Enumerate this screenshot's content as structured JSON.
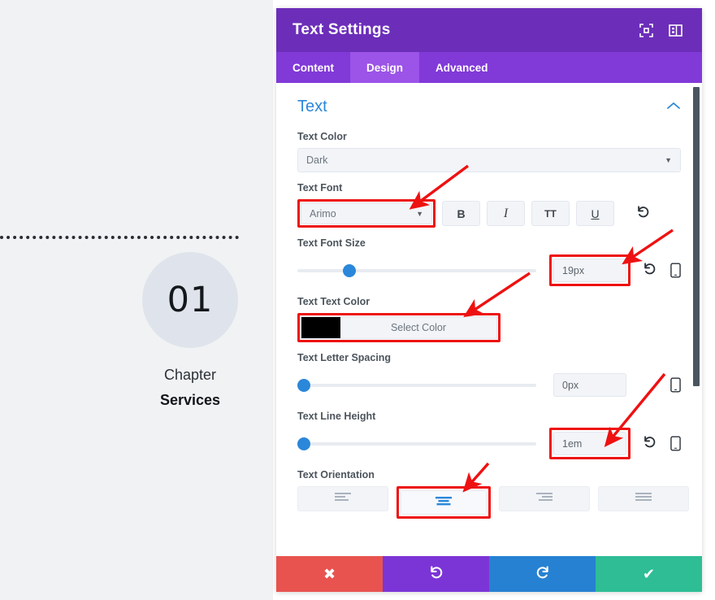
{
  "preview": {
    "chapter_number": "01",
    "chapter_label": "Chapter",
    "chapter_title": "Services",
    "divider_icon": "dotted-divider"
  },
  "panel": {
    "title": "Text Settings",
    "header_icons": [
      {
        "name": "expand-icon",
        "label": "expand"
      },
      {
        "name": "layout-toggle-icon",
        "label": "layout"
      }
    ],
    "tabs": [
      {
        "label": "Content",
        "active": false
      },
      {
        "label": "Design",
        "active": true
      },
      {
        "label": "Advanced",
        "active": false
      }
    ],
    "section": {
      "title": "Text",
      "collapse_icon": "chevron-up-icon"
    },
    "fields": {
      "text_color": {
        "label": "Text Color",
        "value": "Dark",
        "caret_icon": "chevron-down-icon"
      },
      "text_font": {
        "label": "Text Font",
        "value": "Arimo",
        "caret_icon": "chevron-down-icon",
        "highlighted": true,
        "format_buttons": [
          {
            "name": "bold-button",
            "label": "B"
          },
          {
            "name": "italic-button",
            "label": "I"
          },
          {
            "name": "uppercase-button",
            "label": "TT"
          },
          {
            "name": "underline-button",
            "label": "U"
          }
        ],
        "reset_icon": "reset-icon"
      },
      "text_font_size": {
        "label": "Text Font Size",
        "value": "19px",
        "slider_percent": 19,
        "highlighted": true,
        "reset_icon": "reset-icon",
        "device_icon": "mobile-icon"
      },
      "text_text_color": {
        "label": "Text Text Color",
        "button_label": "Select Color",
        "swatch_color": "#000000",
        "highlighted": true
      },
      "text_letter_spacing": {
        "label": "Text Letter Spacing",
        "value": "0px",
        "slider_percent": 0,
        "highlighted": false,
        "device_icon": "mobile-icon"
      },
      "text_line_height": {
        "label": "Text Line Height",
        "value": "1em",
        "slider_percent": 0,
        "highlighted": true,
        "reset_icon": "reset-icon",
        "device_icon": "mobile-icon"
      },
      "text_orientation": {
        "label": "Text Orientation",
        "options": [
          {
            "name": "align-left-button",
            "icon": "align-left-icon",
            "selected": false
          },
          {
            "name": "align-center-button",
            "icon": "align-center-icon",
            "selected": true
          },
          {
            "name": "align-right-button",
            "icon": "align-right-icon",
            "selected": false
          },
          {
            "name": "align-justify-button",
            "icon": "align-justify-icon",
            "selected": false
          }
        ],
        "highlighted_index": 1
      }
    },
    "footer": [
      {
        "name": "cancel-button",
        "icon": "close-icon",
        "glyph": "✖",
        "color": "#e8534f"
      },
      {
        "name": "undo-button",
        "icon": "undo-icon",
        "glyph": "↺",
        "color": "#7b35d6"
      },
      {
        "name": "redo-button",
        "icon": "redo-icon",
        "glyph": "↻",
        "color": "#2681d2"
      },
      {
        "name": "save-button",
        "icon": "check-icon",
        "glyph": "✔",
        "color": "#2ebd95"
      }
    ],
    "scrollbar": {
      "name": "panel-scrollbar"
    }
  },
  "annotation": {
    "color": "#ee1111",
    "arrow_count": 6
  }
}
